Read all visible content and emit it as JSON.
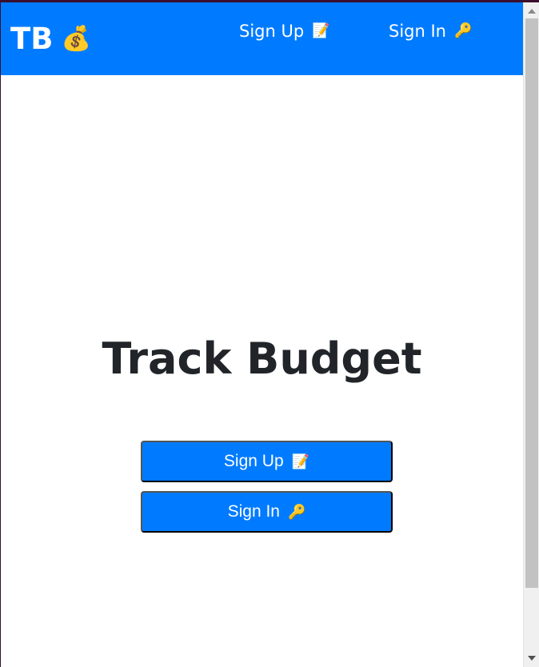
{
  "navbar": {
    "brand_text": "TB",
    "brand_icon": "💰",
    "links": [
      {
        "label": "Sign Up",
        "icon": "📝"
      },
      {
        "label": "Sign In",
        "icon": "🔑"
      }
    ],
    "color": "#007bff"
  },
  "main": {
    "title": "Track Budget",
    "buttons": [
      {
        "label": "Sign Up",
        "icon": "📝"
      },
      {
        "label": "Sign In",
        "icon": "🔑"
      }
    ]
  },
  "colors": {
    "primary": "#007bff",
    "text": "#212529",
    "background": "#ffffff"
  }
}
